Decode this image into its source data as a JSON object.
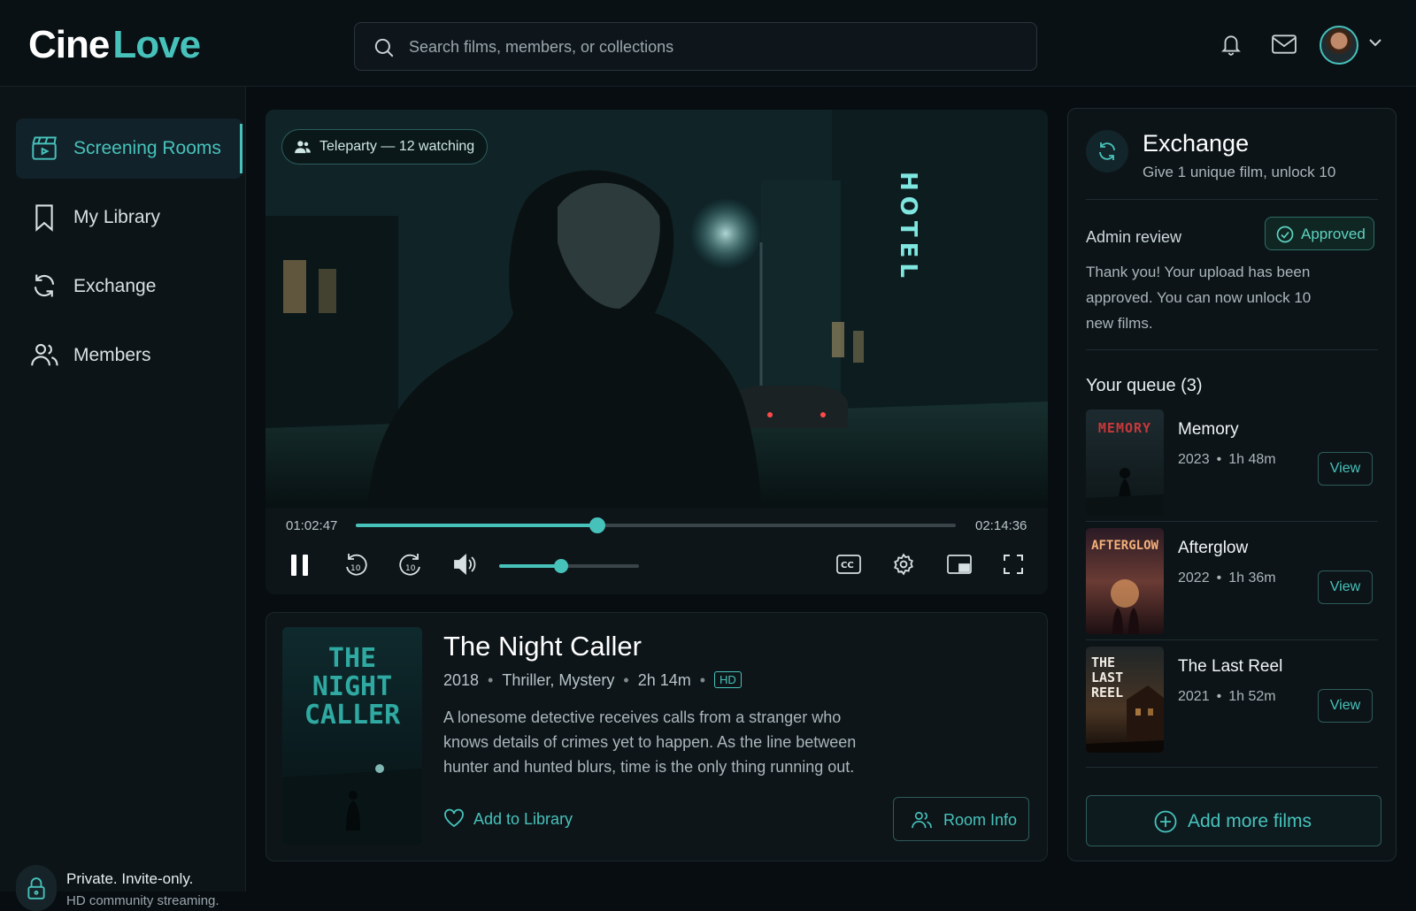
{
  "app": {
    "brand_part1": "Cine",
    "brand_part2": "Love",
    "accent_color": "#47c2bb"
  },
  "header": {
    "search_placeholder": "Search films, members, or collections",
    "icons": [
      "search-icon",
      "bell-icon",
      "mail-icon",
      "avatar",
      "chevron-down-icon"
    ]
  },
  "sidebar": {
    "items": [
      {
        "label": "Screening Rooms",
        "icon": "clapperboard-icon",
        "active": true
      },
      {
        "label": "My Library",
        "icon": "bookmark-icon",
        "active": false
      },
      {
        "label": "Exchange",
        "icon": "refresh-icon",
        "active": false
      },
      {
        "label": "Members",
        "icon": "users-icon",
        "active": false
      }
    ],
    "footer_title": "Private. Invite-only.",
    "footer_subtitle": "HD community streaming."
  },
  "player": {
    "party_badge": "Teleparty — 12 watching",
    "current_time": "01:02:47",
    "total_time": "02:14:36",
    "progress_fraction": 0.402,
    "volume_fraction": 0.44,
    "scene_sign": "HOTEL"
  },
  "film": {
    "title": "The Night Caller",
    "poster_text": "THE\nNIGHT\nCALLER",
    "year": "2018",
    "genres": "Thriller, Mystery",
    "duration": "2h 14m",
    "quality": "HD",
    "description": "A lonesome detective receives calls from a stranger who knows details of crimes yet to happen. As the line between hunter and hunted blurs, time is the only thing running out.",
    "add_to_library": "Add to Library",
    "room_info": "Room Info"
  },
  "exchange": {
    "title": "Exchange",
    "subtitle": "Give 1 unique film, unlock 10",
    "admin_review_label": "Admin review",
    "status": "Approved",
    "message": "Thank you! Your upload has been approved. You can now unlock 10 new films.",
    "queue_heading": "Your queue (3)",
    "queue": [
      {
        "title": "Memory",
        "poster_text": "MEMORY",
        "year": "2023",
        "duration": "1h 48m",
        "action": "View"
      },
      {
        "title": "Afterglow",
        "poster_text": "AFTERGLOW",
        "year": "2022",
        "duration": "1h 36m",
        "action": "View"
      },
      {
        "title": "The Last Reel",
        "poster_text": "THE\nLAST\nREEL",
        "year": "2021",
        "duration": "1h 52m",
        "action": "View"
      }
    ],
    "add_more": "Add more films"
  }
}
